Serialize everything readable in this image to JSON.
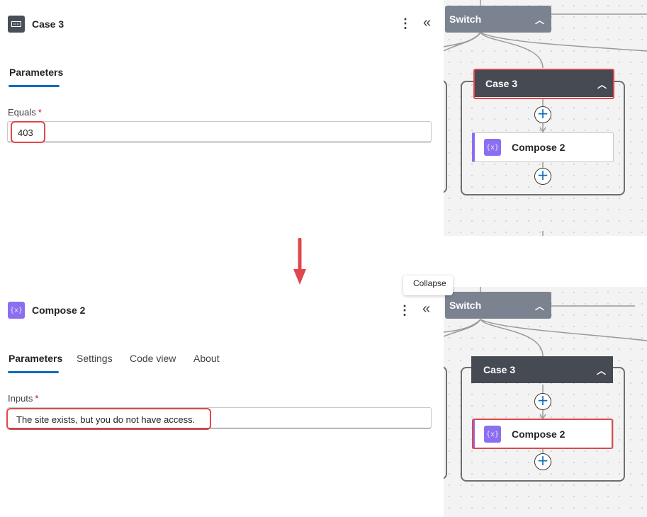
{
  "top_panel": {
    "title": "Case 3",
    "icon": "switch-case-icon",
    "tabs": [
      {
        "label": "Parameters",
        "active": true
      }
    ],
    "field_label": "Equals",
    "required_mark": "*",
    "field_value": "403"
  },
  "bottom_panel": {
    "title": "Compose 2",
    "icon": "compose-icon",
    "tabs": [
      {
        "label": "Parameters",
        "active": true
      },
      {
        "label": "Settings",
        "active": false
      },
      {
        "label": "Code view",
        "active": false
      },
      {
        "label": "About",
        "active": false
      }
    ],
    "field_label": "Inputs",
    "required_mark": "*",
    "field_value": "The site exists, but you do not have access."
  },
  "canvas": {
    "switch_label": "Switch",
    "case_label": "Case 3",
    "compose_label": "Compose 2",
    "compose_glyph": "{x}",
    "add_glyph": "+",
    "tooltip": "Collapse"
  },
  "colors": {
    "highlight": "#e0474c",
    "accent": "#0f6cbd",
    "compose": "#8b6ff0",
    "case_node": "#464b53",
    "switch_node": "#7b8290"
  }
}
